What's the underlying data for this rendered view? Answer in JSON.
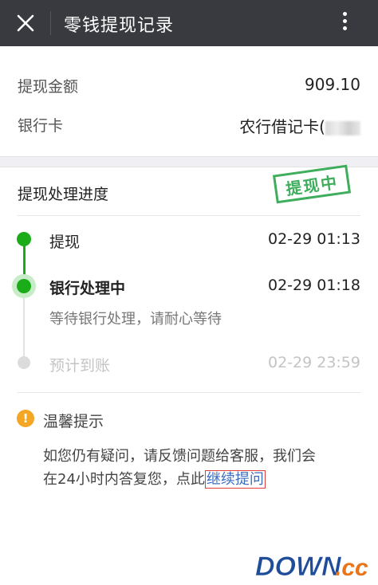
{
  "header": {
    "title": "零钱提现记录",
    "close_icon": "close-icon",
    "more_icon": "more-vertical-icon"
  },
  "summary": {
    "amount_label": "提现金额",
    "amount_value": "909.10",
    "bank_label": "银行卡",
    "bank_value": "农行借记卡("
  },
  "progress": {
    "title": "提现处理进度",
    "stamp": "提现中",
    "steps": [
      {
        "label": "提现",
        "time": "02-29 01:13"
      },
      {
        "label": "银行处理中",
        "time": "02-29 01:18",
        "note": "等待银行处理，请耐心等待"
      },
      {
        "label": "预计到账",
        "time": "02-29 23:59"
      }
    ]
  },
  "tip": {
    "icon": "!",
    "title": "温馨提示",
    "body_line1": "如您仍有疑问，请反馈问题给客服，我们会",
    "body_line2": "在24小时内答复您，点此",
    "link": "继续提问"
  },
  "watermark": {
    "text_main": "DOWN",
    "text_suffix": ".cc"
  },
  "colors": {
    "header_bg": "#393a3f",
    "accent_green": "#1aad19",
    "link_blue": "#3a6bbd",
    "tip_orange": "#f5a623"
  }
}
